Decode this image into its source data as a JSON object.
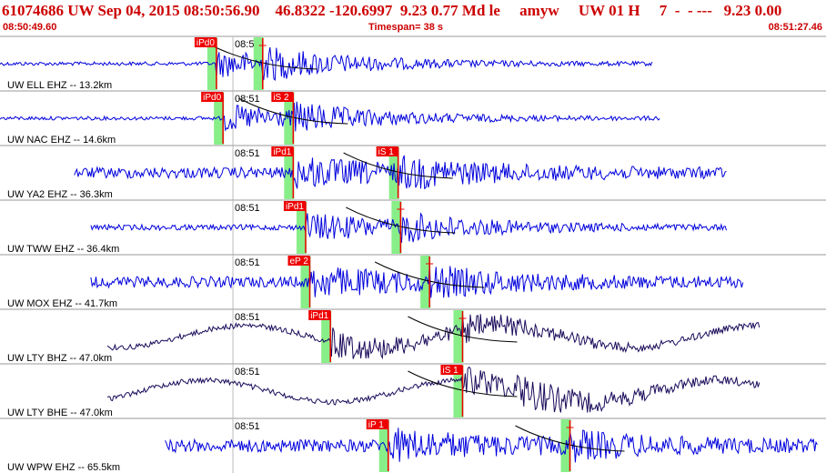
{
  "header": {
    "title": "61074686 UW Sep 04, 2015 08:50:56.90    46.8322 -120.6997  9.23 0.77 Md le     amyw     UW 01 H     7  -  - ---   9.23 0.00",
    "start_time": "08:50:49.60",
    "timespan": "Timespan=  38 s",
    "end_time": "08:51:27.46"
  },
  "colors": {
    "trace": "#0000dd",
    "trace_dark": "#1a0a5a",
    "pick": "#ee0000",
    "window": "#88ee88",
    "grid": "#aaaaaa"
  },
  "traces": [
    {
      "station": "UW ELL EHZ -- 13.2km",
      "tick": "08:51",
      "color": "#0000dd",
      "picks": [
        {
          "label": "iPd0",
          "t": 0.262
        },
        {
          "label": "",
          "t": 0.318
        }
      ]
    },
    {
      "station": "UW NAC EHZ -- 14.6km",
      "tick": "08:51",
      "color": "#0000dd",
      "picks": [
        {
          "label": "iPd0",
          "t": 0.27
        },
        {
          "label": "iS 2",
          "t": 0.355
        }
      ]
    },
    {
      "station": "UW YA2 EHZ -- 36.3km",
      "tick": "08:51",
      "color": "#0000dd",
      "picks": [
        {
          "label": "iPd1",
          "t": 0.355
        },
        {
          "label": "iS 1",
          "t": 0.482
        }
      ]
    },
    {
      "station": "UW TWW EHZ -- 36.4km",
      "tick": "08:51",
      "color": "#0000dd",
      "picks": [
        {
          "label": "iPd1",
          "t": 0.37
        },
        {
          "label": "",
          "t": 0.485
        }
      ]
    },
    {
      "station": "UW MOX EHZ -- 41.7km",
      "tick": "08:51",
      "color": "#0000dd",
      "picks": [
        {
          "label": "eP 2",
          "t": 0.375
        },
        {
          "label": "",
          "t": 0.52
        }
      ]
    },
    {
      "station": "UW LTY BHZ -- 47.0km",
      "tick": "08:51",
      "color": "#1a0a5a",
      "picks": [
        {
          "label": "iPd1",
          "t": 0.4
        },
        {
          "label": "",
          "t": 0.56
        }
      ]
    },
    {
      "station": "UW LTY BHE -- 47.0km",
      "tick": "08:51",
      "color": "#1a0a5a",
      "picks": [
        {
          "label": "iS 1",
          "t": 0.56
        }
      ]
    },
    {
      "station": "UW WPW EHZ -- 65.5km",
      "tick": "08:51",
      "color": "#0000dd",
      "picks": [
        {
          "label": "iP 1",
          "t": 0.47
        },
        {
          "label": "",
          "t": 0.69
        }
      ]
    }
  ]
}
